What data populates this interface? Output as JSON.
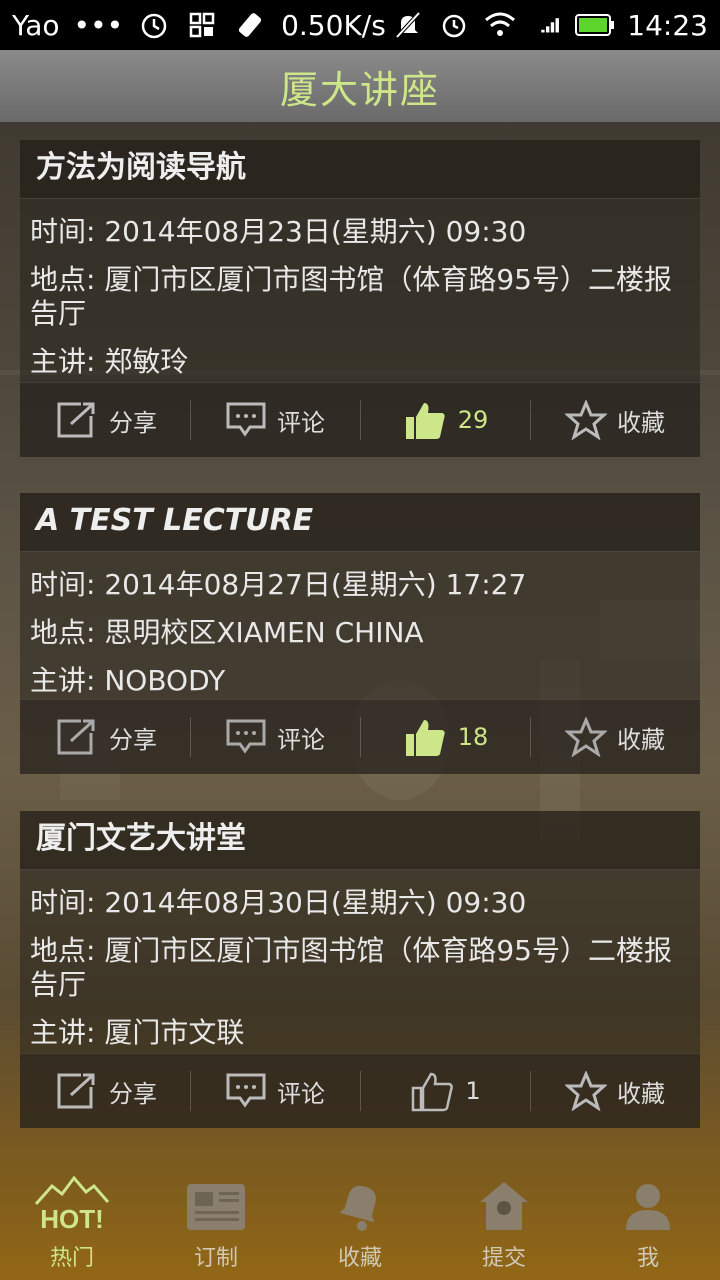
{
  "status_bar": {
    "carrier": "Yao",
    "dots": "•••",
    "speed": "0.50K/s",
    "time": "14:23"
  },
  "header": {
    "title": "厦大讲座"
  },
  "lectures": [
    {
      "title": "方法为阅读导航",
      "time": "时间: 2014年08月23日(星期六) 09:30",
      "place": "地点: 厦门市区厦门市图书馆（体育路95号）二楼报告厅",
      "speaker": "主讲: 郑敏玲",
      "share_label": "分享",
      "comment_label": "评论",
      "likes": "29",
      "favorite_label": "收藏",
      "liked": true
    },
    {
      "title": "A TEST LECTURE",
      "time": "时间: 2014年08月27日(星期六) 17:27",
      "place": "地点: 思明校区XIAMEN CHINA",
      "speaker": "主讲: NOBODY",
      "share_label": "分享",
      "comment_label": "评论",
      "likes": "18",
      "favorite_label": "收藏",
      "liked": true
    },
    {
      "title": "厦门文艺大讲堂",
      "time": "时间: 2014年08月30日(星期六) 09:30",
      "place": "地点: 厦门市区厦门市图书馆（体育路95号）二楼报告厅",
      "speaker": "主讲: 厦门市文联",
      "share_label": "分享",
      "comment_label": "评论",
      "likes": "1",
      "favorite_label": "收藏",
      "liked": false
    }
  ],
  "tabs": [
    {
      "label": "热门",
      "icon": "hot-icon",
      "active": true,
      "icon_text": "HOT!"
    },
    {
      "label": "订制",
      "icon": "newspaper-icon",
      "active": false
    },
    {
      "label": "收藏",
      "icon": "bell-icon",
      "active": false
    },
    {
      "label": "提交",
      "icon": "birdhouse-icon",
      "active": false
    },
    {
      "label": "我",
      "icon": "person-icon",
      "active": false
    }
  ],
  "colors": {
    "accent": "#cde68a",
    "header_bg": "#7a7a7a"
  }
}
